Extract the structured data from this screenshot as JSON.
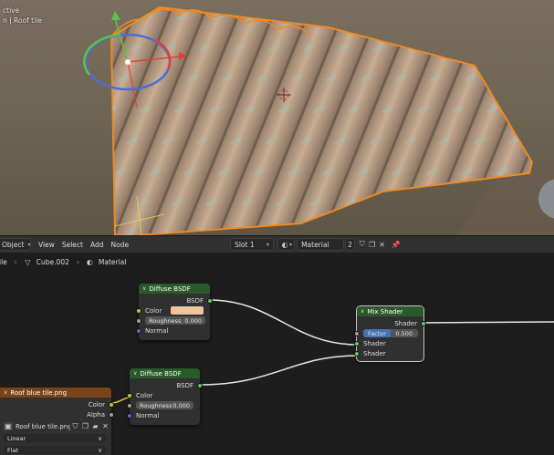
{
  "viewport": {
    "mode_fragment": "ctive",
    "object_fragment": "n | Roof tile"
  },
  "header": {
    "object_mode": "Object",
    "menus": [
      "View",
      "Select",
      "Add",
      "Node"
    ],
    "slot": "Slot 1",
    "material_name": "Material",
    "user_count": "2"
  },
  "breadcrumb": {
    "file_fragment": "ile",
    "object": "Cube.002",
    "material": "Material"
  },
  "nodes": {
    "diffuse1": {
      "title": "Diffuse BSDF",
      "output": "BSDF",
      "color_label": "Color",
      "color_value": "#f0c49c",
      "roughness_label": "Roughness",
      "roughness_value": "0.000",
      "normal_label": "Normal"
    },
    "diffuse2": {
      "title": "Diffuse BSDF",
      "output": "BSDF",
      "color_label": "Color",
      "roughness_label": "Roughness",
      "roughness_value": "0.000",
      "normal_label": "Normal"
    },
    "mix": {
      "title": "Mix Shader",
      "output": "Shader",
      "factor_label": "Factor",
      "factor_value": "0.500",
      "input1": "Shader",
      "input2": "Shader"
    },
    "image_texture": {
      "title": "Roof blue tile.png",
      "out_color": "Color",
      "out_alpha": "Alpha",
      "image_name": "Roof blue tile.png",
      "interpolation": "Linear",
      "projection": "Flat"
    }
  },
  "colors": {
    "shader_header": "#2a5a2a",
    "texture_header": "#7a4418",
    "factor_field": "#4772b3",
    "selection_outline": "#f08a24"
  }
}
